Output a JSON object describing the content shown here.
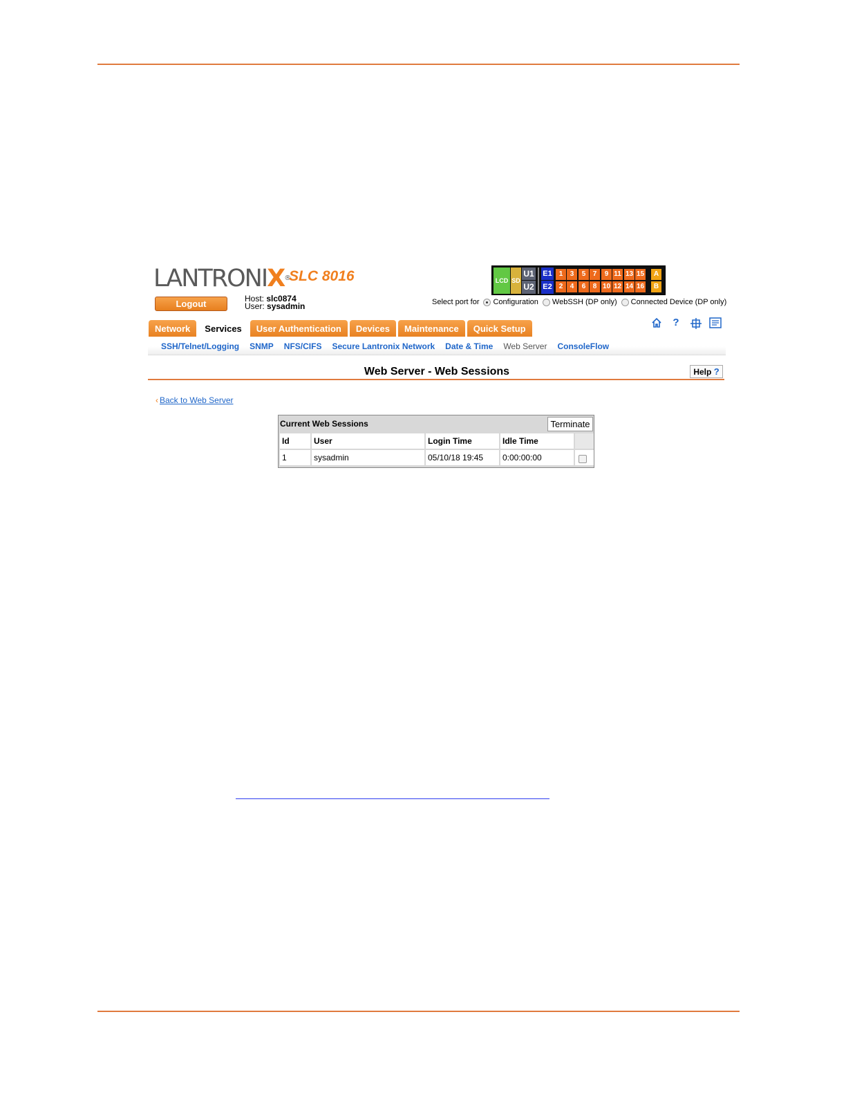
{
  "brand": {
    "logo_main": "LANTRONI",
    "logo_x": "X",
    "logo_reg": "®",
    "model": "SLC 8016"
  },
  "header": {
    "logout_label": "Logout",
    "host_label": "Host:",
    "host_value": "slc0874",
    "user_label": "User:",
    "user_value": "sysadmin"
  },
  "ports": {
    "lcd": "LCD",
    "sd": "SD",
    "u1": "U1",
    "u2": "U2",
    "e1": "E1",
    "e2": "E2",
    "top_row": [
      "1",
      "3",
      "5",
      "7",
      "9",
      "11",
      "13",
      "15"
    ],
    "bottom_row": [
      "2",
      "4",
      "6",
      "8",
      "10",
      "12",
      "14",
      "16"
    ],
    "a": "A",
    "b": "B"
  },
  "select_port": {
    "label": "Select port for",
    "options": [
      "Configuration",
      "WebSSH (DP only)",
      "Connected Device (DP only)"
    ],
    "selected": "Configuration"
  },
  "tabs": [
    "Network",
    "Services",
    "User Authentication",
    "Devices",
    "Maintenance",
    "Quick Setup"
  ],
  "active_tab": "Services",
  "toolbar_icons": [
    "home-icon",
    "help-icon",
    "sitemap-icon",
    "log-icon"
  ],
  "subnav": [
    "SSH/Telnet/Logging",
    "SNMP",
    "NFS/CIFS",
    "Secure Lantronix Network",
    "Date & Time",
    "Web Server",
    "ConsoleFlow"
  ],
  "subnav_current": "Web Server",
  "page": {
    "title": "Web Server - Web Sessions",
    "help_label": "Help",
    "help_q": "?",
    "back_link": "Back to Web Server"
  },
  "sessions": {
    "heading": "Current Web Sessions",
    "terminate_label": "Terminate",
    "columns": [
      "Id",
      "User",
      "Login Time",
      "Idle Time"
    ],
    "rows": [
      [
        "1",
        "sysadmin",
        "05/10/18 19:45",
        "0:00:00:00"
      ]
    ]
  },
  "colors": {
    "accent": "#f07f1e",
    "link": "#1f66c9",
    "rule": "#e07a3e"
  }
}
